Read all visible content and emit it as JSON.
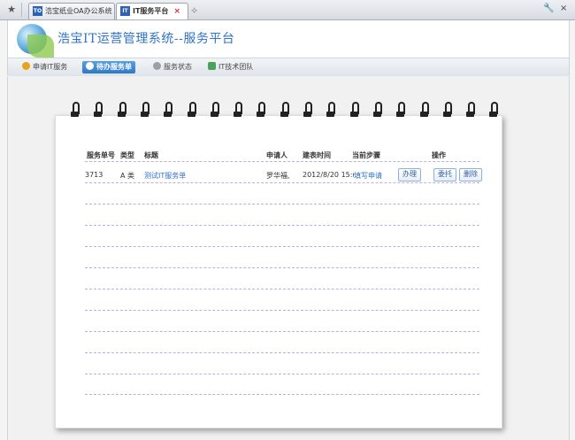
{
  "browser": {
    "tabs": [
      {
        "icon": "TO",
        "label": "浩宝纸业OA办公系统",
        "active": false
      },
      {
        "icon": "IT",
        "label": "IT服务平台",
        "active": true
      }
    ],
    "left_icon": "★",
    "close_glyph": "×",
    "newtab_glyph": "⟡",
    "right_icons": [
      "🔧",
      "×"
    ]
  },
  "header": {
    "title": "浩宝IT运营管理系统--服务平台"
  },
  "nav": {
    "items": [
      {
        "label": "申请IT服务",
        "icon": "star-icon",
        "color": "#e9a21b",
        "active": false
      },
      {
        "label": "待办服务单",
        "icon": "clock-icon",
        "color": "#ffffff",
        "active": true
      },
      {
        "label": "服务状态",
        "icon": "gear-icon",
        "color": "#9aa0a8",
        "active": false
      },
      {
        "label": "IT技术团队",
        "icon": "team-icon",
        "color": "#4aa35a",
        "active": false
      }
    ]
  },
  "table": {
    "headers": {
      "id": "服务单号",
      "type": "类型",
      "title": "标题",
      "requester": "申请人",
      "created": "建表时间",
      "step": "当前步骤",
      "actions": "操作"
    },
    "rows": [
      {
        "id": "3713",
        "type": "A 类",
        "title": "测试IT服务单",
        "requester": "罗华福,",
        "created": "2012/8/20 15:(",
        "step": "填写申请",
        "btn_handle": "办理",
        "btn_delegate": "委托",
        "btn_delete": "删除"
      }
    ]
  },
  "colors": {
    "accent": "#2f73c8",
    "link": "#2e6fc9",
    "rule": "#b6b0e6"
  }
}
